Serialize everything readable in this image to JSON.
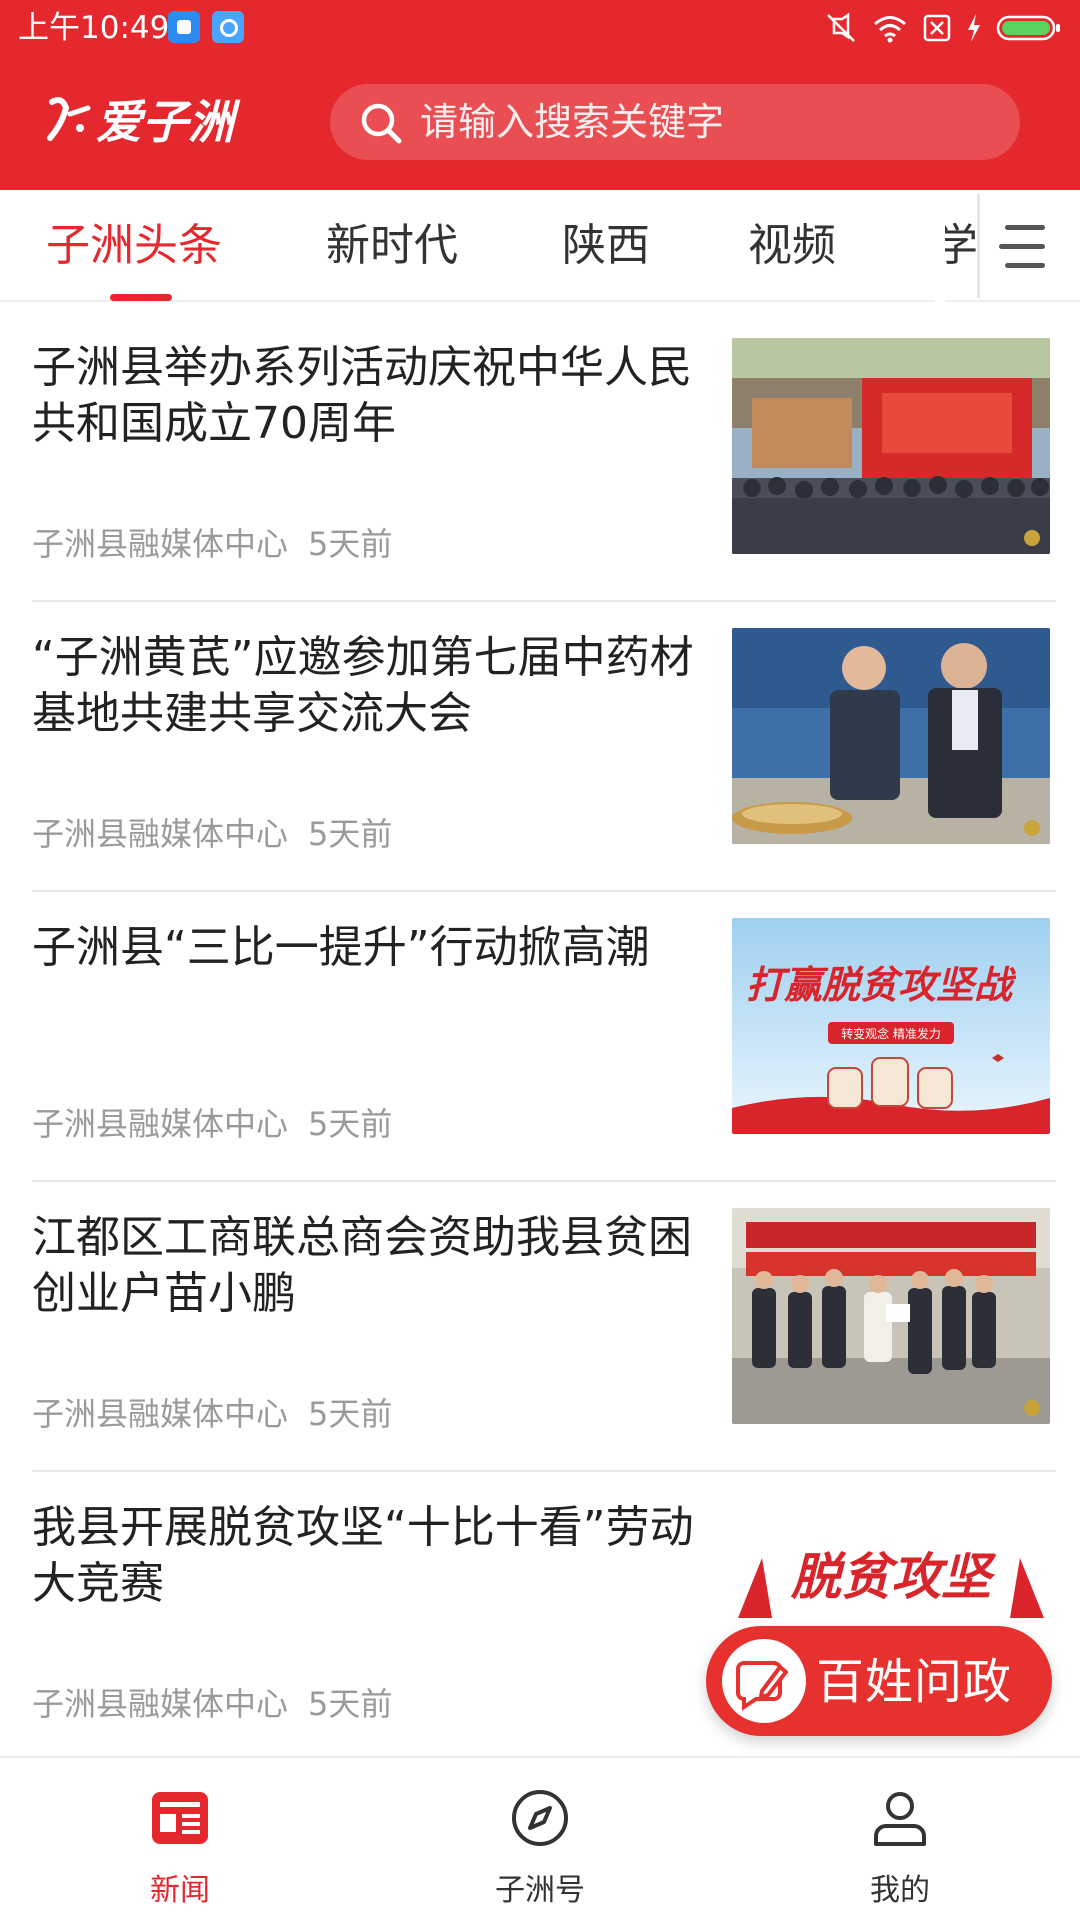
{
  "status_bar": {
    "time": "上午10:49"
  },
  "header": {
    "logo_text": "爱子洲",
    "search_placeholder": "请输入搜索关键字"
  },
  "tabs": [
    {
      "label": "子洲头条",
      "active": true
    },
    {
      "label": "新时代",
      "active": false
    },
    {
      "label": "陕西",
      "active": false
    },
    {
      "label": "视频",
      "active": false
    },
    {
      "label": "学",
      "active": false
    }
  ],
  "news": [
    {
      "title": "子洲县举办系列活动庆祝中华人民共和国成立70周年",
      "source": "子洲县融媒体中心",
      "time": "5天前",
      "thumb": "celebration-stage-photo"
    },
    {
      "title": "“子洲黄芪”应邀参加第七届中药材基地共建共享交流大会",
      "source": "子洲县融媒体中心",
      "time": "5天前",
      "thumb": "expo-booth-photo"
    },
    {
      "title": "子洲县“三比一提升”行动掀高潮",
      "source": "子洲县融媒体中心",
      "time": "5天前",
      "thumb": "poverty-campaign-banner"
    },
    {
      "title": "江都区工商联总商会资助我县贫困创业户苗小鹏",
      "source": "子洲县融媒体中心",
      "time": "5天前",
      "thumb": "donation-ceremony-photo"
    },
    {
      "title": "我县开展脱贫攻坚“十比十看”劳动大竞赛",
      "source": "子洲县融媒体中心",
      "time": "5天前",
      "thumb": "poverty-campaign-banner-2"
    }
  ],
  "thumb_text": {
    "banner_main": "打赢脱贫攻坚战",
    "banner_sub": "转变观念 精准发力",
    "banner2_main": "脱贫攻坚"
  },
  "fab": {
    "label": "百姓问政"
  },
  "bottom_nav": [
    {
      "label": "新闻",
      "icon": "news-icon",
      "active": true
    },
    {
      "label": "子洲号",
      "icon": "compass-icon",
      "active": false
    },
    {
      "label": "我的",
      "icon": "user-icon",
      "active": false
    }
  ],
  "colors": {
    "brand": "#e5282e",
    "text": "#222222",
    "meta": "#9a9a9a"
  }
}
